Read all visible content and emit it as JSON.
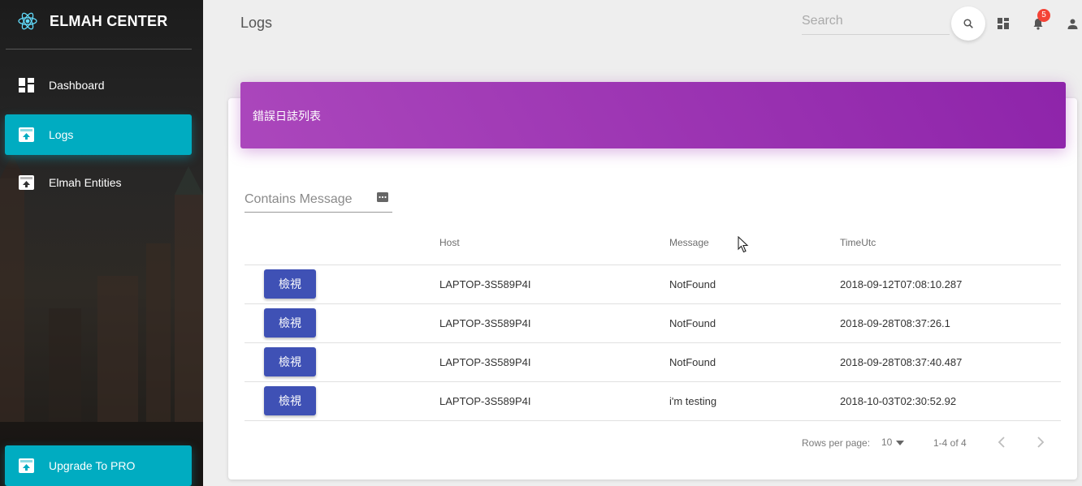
{
  "brand": {
    "name": "ELMAH CENTER",
    "icon": "react-icon"
  },
  "sidebar": {
    "items": [
      {
        "label": "Dashboard",
        "icon": "dashboard-icon",
        "active": false
      },
      {
        "label": "Logs",
        "icon": "unarchive-icon",
        "active": true
      },
      {
        "label": "Elmah Entities",
        "icon": "unarchive-icon",
        "active": false
      }
    ],
    "upgrade": {
      "label": "Upgrade To PRO",
      "icon": "unarchive-icon"
    }
  },
  "header": {
    "title": "Logs",
    "search_placeholder": "Search",
    "notification_count": "5"
  },
  "card": {
    "title": "錯誤日誌列表",
    "filter_placeholder": "Contains Message"
  },
  "table": {
    "columns": [
      "",
      "Host",
      "Message",
      "TimeUtc"
    ],
    "rows": [
      {
        "action": "檢視",
        "host": "LAPTOP-3S589P4I",
        "message": "NotFound",
        "time": "2018-09-12T07:08:10.287"
      },
      {
        "action": "檢視",
        "host": "LAPTOP-3S589P4I",
        "message": "NotFound",
        "time": "2018-09-28T08:37:26.1"
      },
      {
        "action": "檢視",
        "host": "LAPTOP-3S589P4I",
        "message": "NotFound",
        "time": "2018-09-28T08:37:40.487"
      },
      {
        "action": "檢視",
        "host": "LAPTOP-3S589P4I",
        "message": "i'm testing",
        "time": "2018-10-03T02:30:52.92"
      }
    ]
  },
  "pagination": {
    "rows_per_page_label": "Rows per page:",
    "rows_per_page": "10",
    "range": "1-4 of 4"
  },
  "colors": {
    "active_nav": "#00acc1",
    "card_header": "#9c27b0",
    "view_button": "#3f51b5",
    "badge": "#f44336"
  }
}
